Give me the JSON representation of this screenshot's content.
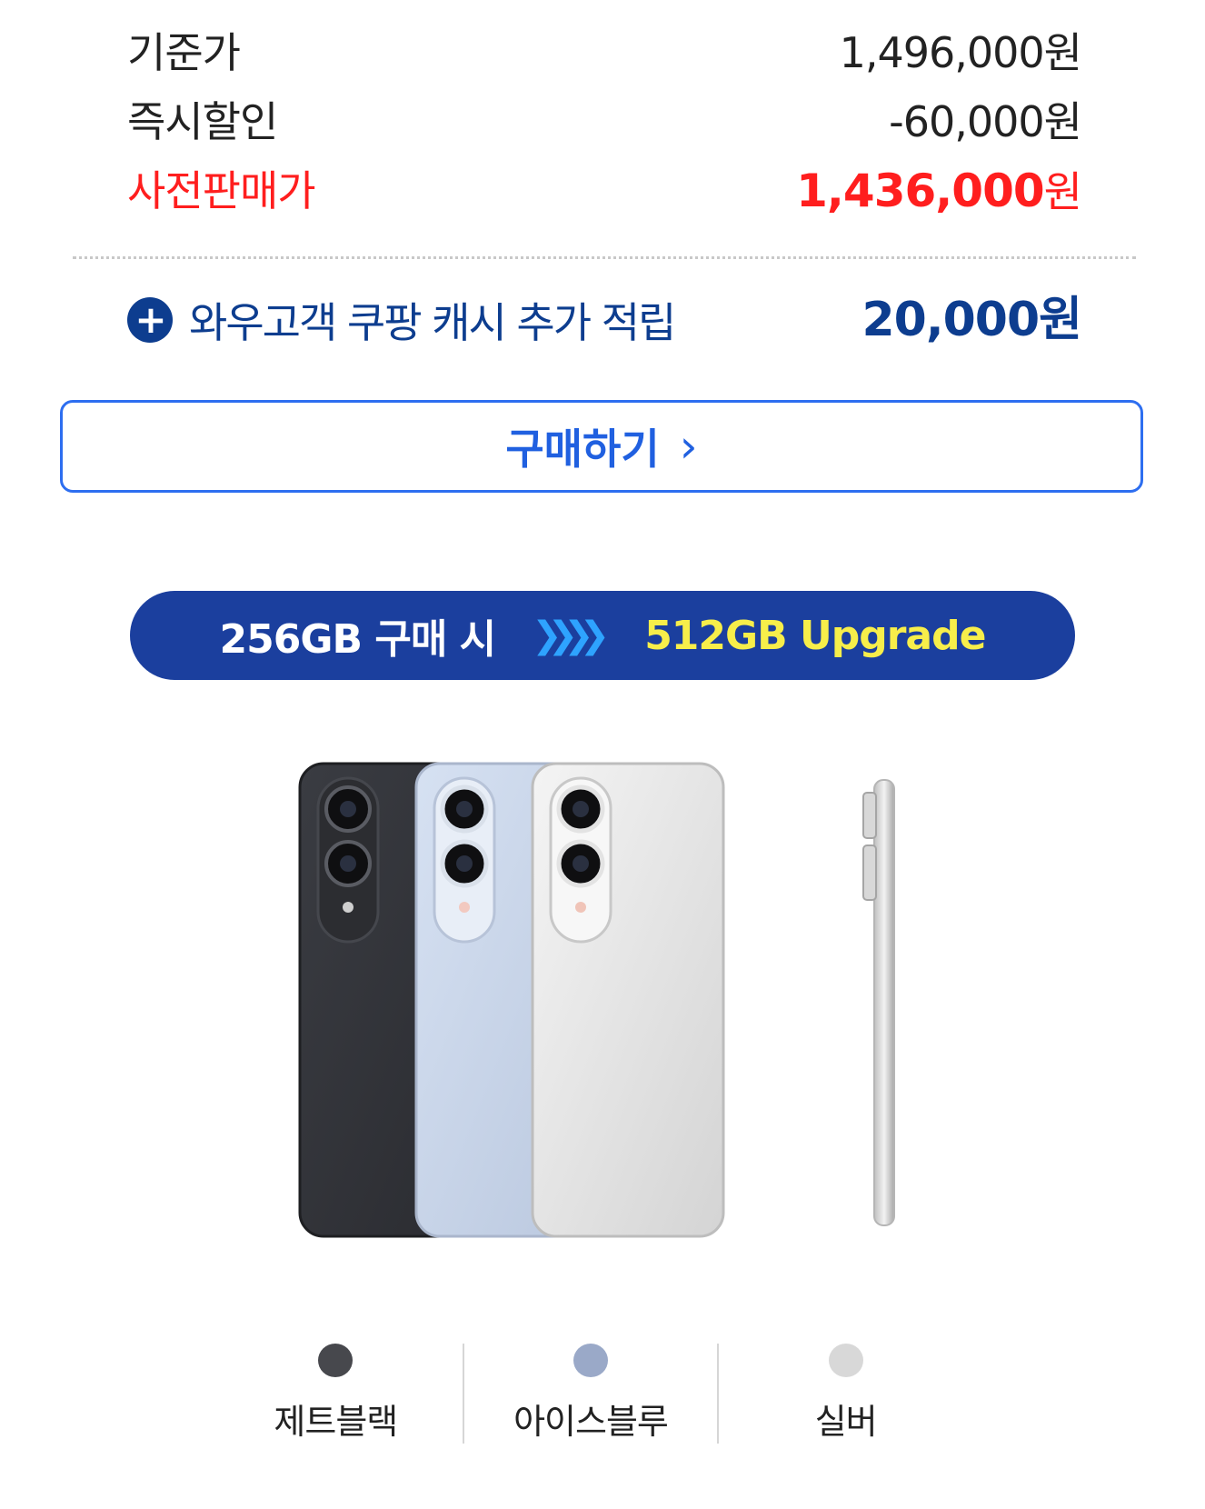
{
  "price_table": {
    "base": {
      "label": "기준가",
      "value": "1,496,000원"
    },
    "discount": {
      "label": "즉시할인",
      "value": "-60,000원"
    },
    "presale": {
      "label": "사전판매가",
      "amount": "1,436,000",
      "currency": "원"
    }
  },
  "cashback": {
    "label": "와우고객 쿠팡 캐시 추가 적립",
    "value": "20,000원"
  },
  "buy_button": {
    "label": "구매하기"
  },
  "upgrade_banner": {
    "left": "256GB 구매 시",
    "arrows": "❯❯❯❯",
    "right": "512GB Upgrade"
  },
  "colors": [
    {
      "name": "제트블랙",
      "hex": "#47484d"
    },
    {
      "name": "아이스블루",
      "hex": "#9aa9c8"
    },
    {
      "name": "실버",
      "hex": "#d8d8d8"
    }
  ],
  "accent_colors": {
    "sale_red": "#ff1e1e",
    "cash_navy": "#0d3d8f",
    "button_blue": "#2d6ef0",
    "banner_bg": "#1b3f9e",
    "banner_highlight": "#f7ee4a"
  }
}
